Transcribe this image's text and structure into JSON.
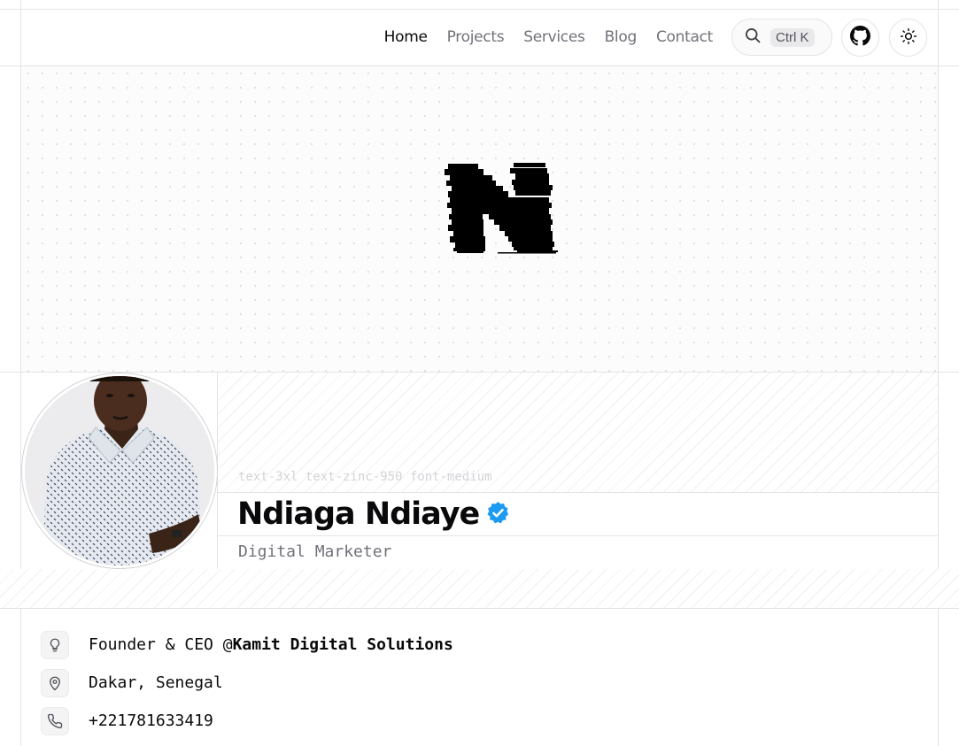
{
  "nav": {
    "items": [
      {
        "label": "Home",
        "active": true
      },
      {
        "label": "Projects",
        "active": false
      },
      {
        "label": "Services",
        "active": false
      },
      {
        "label": "Blog",
        "active": false
      },
      {
        "label": "Contact",
        "active": false
      }
    ],
    "search_shortcut": "Ctrl K",
    "icons": [
      "search-icon",
      "github-icon",
      "sun-icon"
    ]
  },
  "hero": {
    "logo_letter": "N"
  },
  "profile": {
    "class_hint": "text-3xl text-zinc-950 font-medium",
    "name": "Ndiaga Ndiaye",
    "verified_icon": "verified-badge-icon",
    "role": "Digital Marketer",
    "badge_color": "#1d9bf0"
  },
  "info": {
    "items": [
      {
        "icon": "lightbulb-icon",
        "prefix": "Founder & CEO @",
        "strong": "Kamit Digital Solutions"
      },
      {
        "icon": "map-pin-icon",
        "prefix": "Dakar, Senegal",
        "strong": ""
      },
      {
        "icon": "phone-icon",
        "prefix": "+221781633419",
        "strong": ""
      }
    ]
  }
}
